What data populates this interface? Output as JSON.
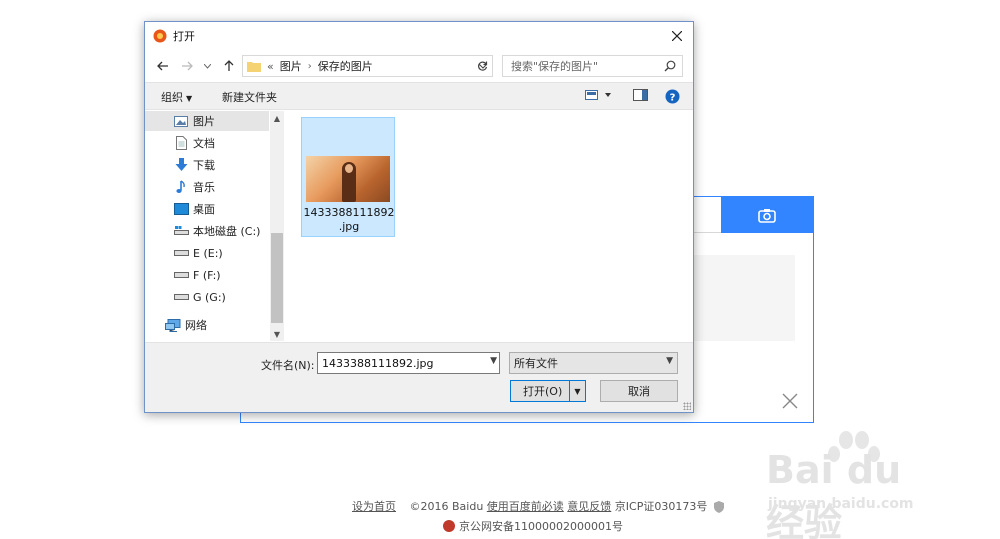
{
  "dialog": {
    "title": "打开",
    "breadcrumb": [
      "«",
      "图片",
      "保存的图片"
    ],
    "search_placeholder": "搜索\"保存的图片\"",
    "toolbar": {
      "organize": "组织",
      "new_folder": "新建文件夹"
    },
    "sidebar": [
      {
        "label": "图片",
        "icon": "pictures-icon",
        "selected": true
      },
      {
        "label": "文档",
        "icon": "documents-icon"
      },
      {
        "label": "下载",
        "icon": "download-icon"
      },
      {
        "label": "音乐",
        "icon": "music-icon"
      },
      {
        "label": "桌面",
        "icon": "desktop-icon"
      },
      {
        "label": "本地磁盘 (C:)",
        "icon": "local-disk-icon"
      },
      {
        "label": "E (E:)",
        "icon": "drive-icon"
      },
      {
        "label": "F (F:)",
        "icon": "drive-icon"
      },
      {
        "label": "G (G:)",
        "icon": "drive-icon"
      },
      {
        "label": "网络",
        "icon": "network-icon"
      }
    ],
    "file": {
      "name_line1": "1433388111892",
      "name_line2": ".jpg"
    },
    "filename_label": "文件名(N):",
    "filename_value": "1433388111892.jpg",
    "filetype_value": "所有文件",
    "open_label": "打开(O)",
    "cancel_label": "取消"
  },
  "footer": {
    "set_home": "设为首页",
    "copyright": "©2016 Baidu",
    "read_first": "使用百度前必读",
    "feedback": "意见反馈",
    "icp": "京ICP证030173号",
    "police": "京公网安备11000002000001号"
  },
  "watermark": {
    "brand": "Bai du 经验",
    "url": "jingyan.baidu.com"
  },
  "colors": {
    "accent": "#3385ff",
    "selection": "#cce8ff",
    "selection_border": "#99d1ff"
  }
}
